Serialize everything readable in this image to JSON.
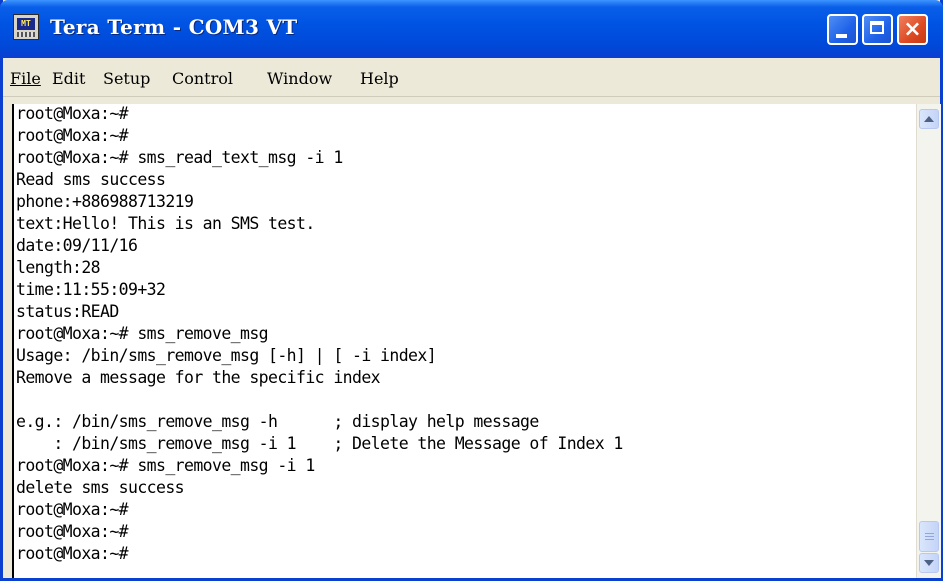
{
  "window": {
    "title": "Tera Term - COM3 VT",
    "icon_text": "MT",
    "buttons": {
      "minimize": "minimize",
      "maximize": "maximize",
      "close": "×"
    }
  },
  "menu": {
    "file": "File",
    "edit": "Edit",
    "setup": "Setup",
    "control": "Control",
    "window": "Window",
    "help": "Help"
  },
  "terminal": {
    "lines": [
      "root@Moxa:~#",
      "root@Moxa:~#",
      "root@Moxa:~# sms_read_text_msg -i 1",
      "Read sms success",
      "phone:+886988713219",
      "text:Hello! This is an SMS test.",
      "date:09/11/16",
      "length:28",
      "time:11:55:09+32",
      "status:READ",
      "root@Moxa:~# sms_remove_msg",
      "Usage: /bin/sms_remove_msg [-h] | [ -i index]",
      "Remove a message for the specific index",
      "",
      "e.g.: /bin/sms_remove_msg -h      ; display help message",
      "    : /bin/sms_remove_msg -i 1    ; Delete the Message of Index 1",
      "root@Moxa:~# sms_remove_msg -i 1",
      "delete sms success",
      "root@Moxa:~#",
      "root@Moxa:~#",
      "root@Moxa:~#"
    ]
  },
  "colors": {
    "titlebar": "#0054e3",
    "menubar": "#ece9d8",
    "terminal_bg": "#ffffff",
    "terminal_fg": "#000000",
    "close_button": "#dc4a22"
  }
}
